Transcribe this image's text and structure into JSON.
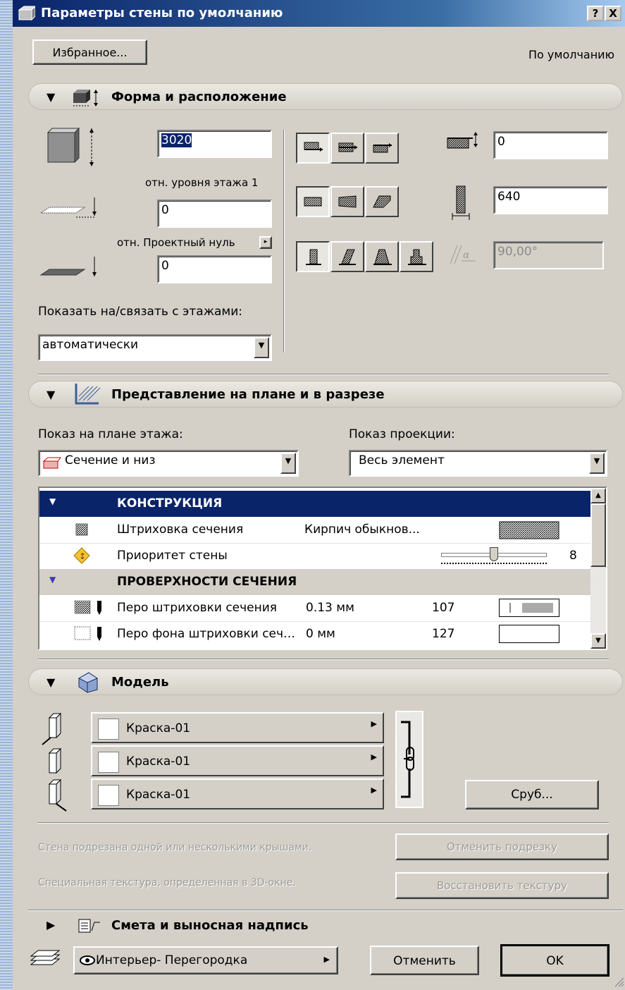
{
  "window": {
    "title": "Параметры стены по умолчанию",
    "help_btn": "?",
    "close_btn": "X"
  },
  "top": {
    "favorites_btn": "Избранное...",
    "default_label": "По умолчанию"
  },
  "shape": {
    "section_title": "Форма и расположение",
    "height_value": "3020",
    "rel_floor_label": "отн. уровня этажа 1",
    "bottom_offset": "0",
    "rel_zero_label": "отн. Проектный нуль",
    "zero_offset": "0",
    "show_floors_label": "Показать на/связать с этажами:",
    "show_floors_value": "автоматически",
    "ref_offset": "0",
    "thickness": "640",
    "angle": "90,00°"
  },
  "plan": {
    "section_title": "Представление на плане и в разрезе",
    "floor_plan_label": "Показ на плане этажа:",
    "floor_plan_value": "Сечение и низ",
    "projection_label": "Показ проекции:",
    "projection_value": "Весь элемент",
    "group1": "КОНСТРУКЦИЯ",
    "rows": [
      {
        "name": "Штриховка сечения",
        "value": "Кирпич обыкнов..."
      },
      {
        "name": "Приоритет стены",
        "value": "8"
      }
    ],
    "group2": "ПРОВЕРХНОСТИ СЕЧЕНИЯ",
    "pen_rows": [
      {
        "name": "Перо штриховки сечения",
        "value": "0.13 мм",
        "num": "107"
      },
      {
        "name": "Перо фона штриховки сеч…",
        "value": "0 мм",
        "num": "127"
      }
    ],
    "priority_fraction": 0.5
  },
  "model": {
    "section_title": "Модель",
    "surfaces": [
      "Краска-01",
      "Краска-01",
      "Краска-01"
    ],
    "log_btn": "Сруб...",
    "roof_trim_note": "Стена подрезана одной или несколькими крышами.",
    "undo_trim_btn": "Отменить подрезку",
    "texture_note": "Специальная текстура, определенная в 3D-окне.",
    "restore_texture_btn": "Восстановить текстуру"
  },
  "listing": {
    "section_title": "Смета и выносная надпись"
  },
  "footer": {
    "layer": "Интерьер- Перегородка",
    "cancel_btn": "Отменить",
    "ok_btn": "OK"
  }
}
